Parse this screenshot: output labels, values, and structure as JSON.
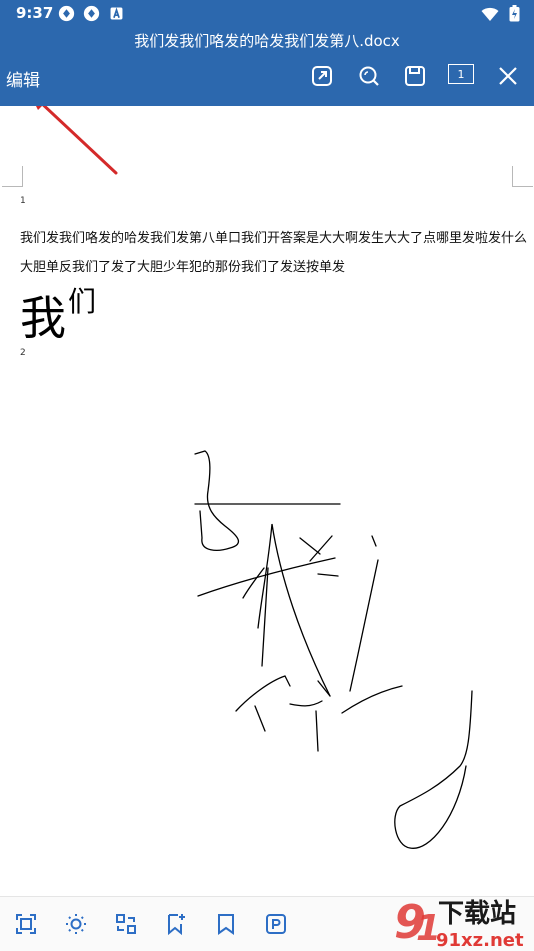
{
  "status_bar": {
    "time": "9:37"
  },
  "app_bar": {
    "document_title": "我们发我们咯发的哈发我们发第八.docx",
    "edit_label": "编辑",
    "page_indicator": "1",
    "toolbar_icons": [
      "share-icon",
      "search-icon",
      "save-icon",
      "page-count-icon",
      "close-icon"
    ]
  },
  "document": {
    "page1_number": "1",
    "line1": "我们发我们咯发的哈发我们发第八单口我们开答案是大大啊发生大大了点哪里发啦发什么",
    "line2": "大胆单反我们了发了大胆少年犯的那份我们了发送按单发",
    "big_char_1": "我",
    "big_char_2": "们",
    "page2_number": "2"
  },
  "bottom_bar": {
    "icons": [
      "fit-page-icon",
      "brightness-icon",
      "convert-icon",
      "add-bookmark-icon",
      "bookmark-icon",
      "pdf-icon"
    ]
  },
  "watermark": {
    "text1": "下载站",
    "text2": "91xz.net"
  },
  "colors": {
    "primary": "#2c68ae",
    "annotation_arrow": "#d42a2a",
    "icon_blue": "#2d6ec5"
  }
}
